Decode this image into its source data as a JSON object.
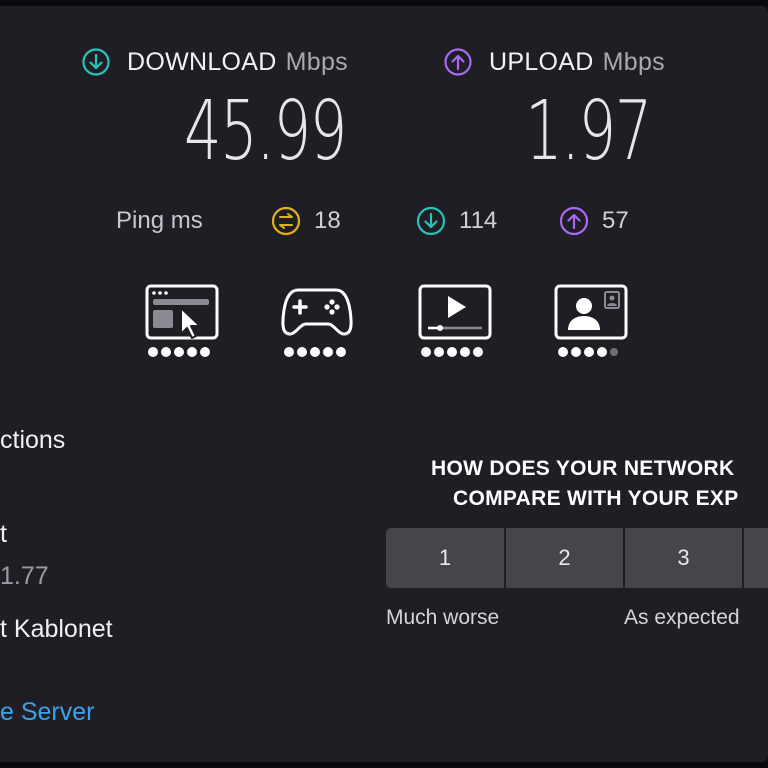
{
  "download": {
    "label": "DOWNLOAD",
    "unit": "Mbps",
    "value": "45.99"
  },
  "upload": {
    "label": "UPLOAD",
    "unit": "Mbps",
    "value": "1.97"
  },
  "ping": {
    "label": "Ping",
    "unit": "ms",
    "idle": "18",
    "download": "114",
    "upload": "57"
  },
  "quality_ratings": [
    {
      "icon": "web-browsing-icon",
      "score": 5
    },
    {
      "icon": "gaming-icon",
      "score": 5
    },
    {
      "icon": "video-streaming-icon",
      "score": 5
    },
    {
      "icon": "video-chat-icon",
      "score": 4
    }
  ],
  "left_panel": {
    "connections_fragment": "ctions",
    "fragment_t": "t",
    "ip_fragment": "1.77",
    "provider_fragment": "t Kablonet",
    "change_server_fragment": "e Server"
  },
  "feedback": {
    "question_line1": "HOW DOES YOUR NETWORK",
    "question_line2": "COMPARE WITH YOUR EXP",
    "options": [
      "1",
      "2",
      "3"
    ],
    "caption_low": "Much worse",
    "caption_mid": "As expected"
  },
  "colors": {
    "download": "#27c3b9",
    "upload": "#a769f0",
    "ping": "#e1b11b",
    "link": "#3ca3ea"
  }
}
